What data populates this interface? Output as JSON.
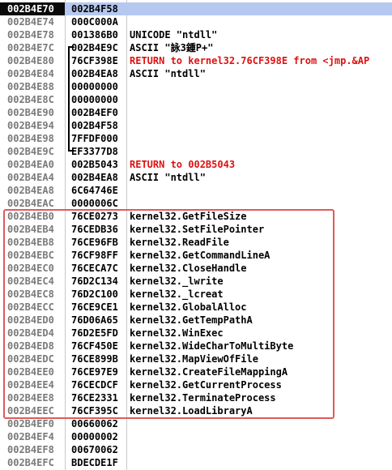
{
  "top_hint": "..., ...",
  "rows": [
    {
      "addr": "002B4E70",
      "val": "002B4F58",
      "comment": "",
      "red": false
    },
    {
      "addr": "002B4E74",
      "val": "000C000A",
      "comment": "",
      "red": false
    },
    {
      "addr": "002B4E78",
      "val": "001386B0",
      "comment": "UNICODE \"ntdll\"",
      "red": false
    },
    {
      "addr": "002B4E7C",
      "val": "002B4E9C",
      "comment": "ASCII \"詠3鍾P+\"",
      "red": false
    },
    {
      "addr": "002B4E80",
      "val": "76CF398E",
      "comment": "RETURN to kernel32.76CF398E from <jmp.&AP",
      "red": true
    },
    {
      "addr": "002B4E84",
      "val": "002B4EA8",
      "comment": "ASCII \"ntdll\"",
      "red": false
    },
    {
      "addr": "002B4E88",
      "val": "00000000",
      "comment": "",
      "red": false
    },
    {
      "addr": "002B4E8C",
      "val": "00000000",
      "comment": "",
      "red": false
    },
    {
      "addr": "002B4E90",
      "val": "002B4EF0",
      "comment": "",
      "red": false
    },
    {
      "addr": "002B4E94",
      "val": "002B4F58",
      "comment": "",
      "red": false
    },
    {
      "addr": "002B4E98",
      "val": "7FFDF000",
      "comment": "",
      "red": false
    },
    {
      "addr": "002B4E9C",
      "val": "EF3377D8",
      "comment": "",
      "red": false
    },
    {
      "addr": "002B4EA0",
      "val": "002B5043",
      "comment": "RETURN to 002B5043",
      "red": true
    },
    {
      "addr": "002B4EA4",
      "val": "002B4EA8",
      "comment": "ASCII \"ntdll\"",
      "red": false
    },
    {
      "addr": "002B4EA8",
      "val": "6C64746E",
      "comment": "",
      "red": false
    },
    {
      "addr": "002B4EAC",
      "val": "0000006C",
      "comment": "",
      "red": false
    },
    {
      "addr": "002B4EB0",
      "val": "76CE0273",
      "comment": "kernel32.GetFileSize",
      "red": false
    },
    {
      "addr": "002B4EB4",
      "val": "76CEDB36",
      "comment": "kernel32.SetFilePointer",
      "red": false
    },
    {
      "addr": "002B4EB8",
      "val": "76CE96FB",
      "comment": "kernel32.ReadFile",
      "red": false
    },
    {
      "addr": "002B4EBC",
      "val": "76CF98FF",
      "comment": "kernel32.GetCommandLineA",
      "red": false
    },
    {
      "addr": "002B4EC0",
      "val": "76CECA7C",
      "comment": "kernel32.CloseHandle",
      "red": false
    },
    {
      "addr": "002B4EC4",
      "val": "76D2C134",
      "comment": "kernel32._lwrite",
      "red": false
    },
    {
      "addr": "002B4EC8",
      "val": "76D2C100",
      "comment": "kernel32._lcreat",
      "red": false
    },
    {
      "addr": "002B4ECC",
      "val": "76CE9CE1",
      "comment": "kernel32.GlobalAlloc",
      "red": false
    },
    {
      "addr": "002B4ED0",
      "val": "76D06A65",
      "comment": "kernel32.GetTempPathA",
      "red": false
    },
    {
      "addr": "002B4ED4",
      "val": "76D2E5FD",
      "comment": "kernel32.WinExec",
      "red": false
    },
    {
      "addr": "002B4ED8",
      "val": "76CF450E",
      "comment": "kernel32.WideCharToMultiByte",
      "red": false
    },
    {
      "addr": "002B4EDC",
      "val": "76CE899B",
      "comment": "kernel32.MapViewOfFile",
      "red": false
    },
    {
      "addr": "002B4EE0",
      "val": "76CE97E9",
      "comment": "kernel32.CreateFileMappingA",
      "red": false
    },
    {
      "addr": "002B4EE4",
      "val": "76CECDCF",
      "comment": "kernel32.GetCurrentProcess",
      "red": false
    },
    {
      "addr": "002B4EE8",
      "val": "76CE2331",
      "comment": "kernel32.TerminateProcess",
      "red": false
    },
    {
      "addr": "002B4EEC",
      "val": "76CF395C",
      "comment": "kernel32.LoadLibraryA",
      "red": false
    },
    {
      "addr": "002B4EF0",
      "val": "00660062",
      "comment": "",
      "red": false
    },
    {
      "addr": "002B4EF4",
      "val": "00000002",
      "comment": "",
      "red": false
    },
    {
      "addr": "002B4EF8",
      "val": "00670062",
      "comment": "",
      "red": false
    },
    {
      "addr": "002B4EFC",
      "val": "BDECDE1F",
      "comment": "",
      "red": false
    }
  ],
  "selected_index": 0,
  "colors": {
    "selected_addr_bg": "#0a0a0a",
    "selected_row_bg": "#b4c8f0",
    "return_comment": "#e01010",
    "highlight_border": "#e05a5a",
    "address_text": "#7a7a7a"
  }
}
